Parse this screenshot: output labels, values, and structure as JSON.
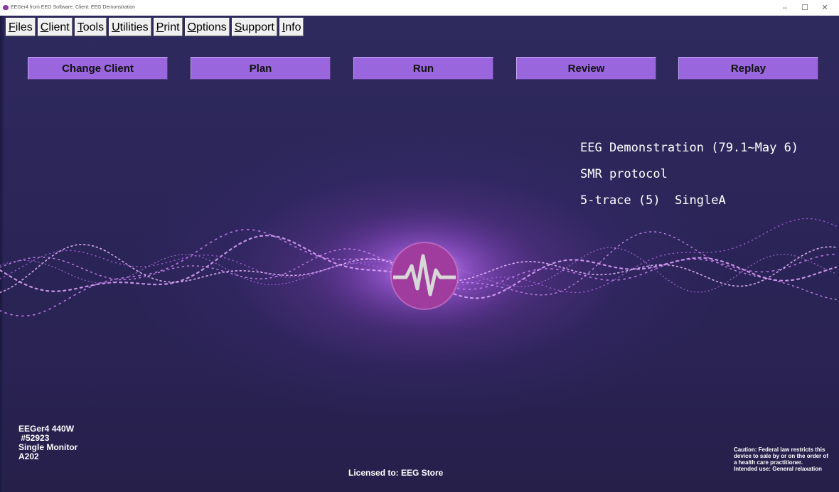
{
  "window": {
    "title": "EEGer4 from EEG Software. Client: EEG Demonstration",
    "minimize": "–",
    "maximize": "☐",
    "close": "✕"
  },
  "menu": [
    {
      "key": "F",
      "rest": "iles"
    },
    {
      "key": "C",
      "rest": "lient"
    },
    {
      "key": "T",
      "rest": "ools"
    },
    {
      "key": "U",
      "rest": "tilities"
    },
    {
      "key": "P",
      "rest": "rint"
    },
    {
      "key": "O",
      "rest": "ptions"
    },
    {
      "key": "S",
      "rest": "upport"
    },
    {
      "key": "I",
      "rest": "nfo"
    }
  ],
  "buttons": {
    "change_client": "Change Client",
    "plan": "Plan",
    "run": "Run",
    "review": "Review",
    "replay": "Replay"
  },
  "session": {
    "client_line": "EEG Demonstration (79.1~May 6)",
    "protocol_line": "SMR protocol",
    "display_line": "5-trace (5)  SingleA"
  },
  "device": {
    "model": "EEGer4 440W",
    "serial": " #52923",
    "monitor": "Single Monitor",
    "code": "A202"
  },
  "license": "Licensed to: EEG Store",
  "caution": {
    "line1": "Caution: Federal law restricts this",
    "line2": "device to sale by or on the order of",
    "line3": "a health care practitioner.",
    "line4": "Intended use: General relaxation"
  },
  "colors": {
    "background": "#2a2456",
    "button": "#9966dd",
    "glow": "#c080ff",
    "logo": "#a03c9e"
  }
}
